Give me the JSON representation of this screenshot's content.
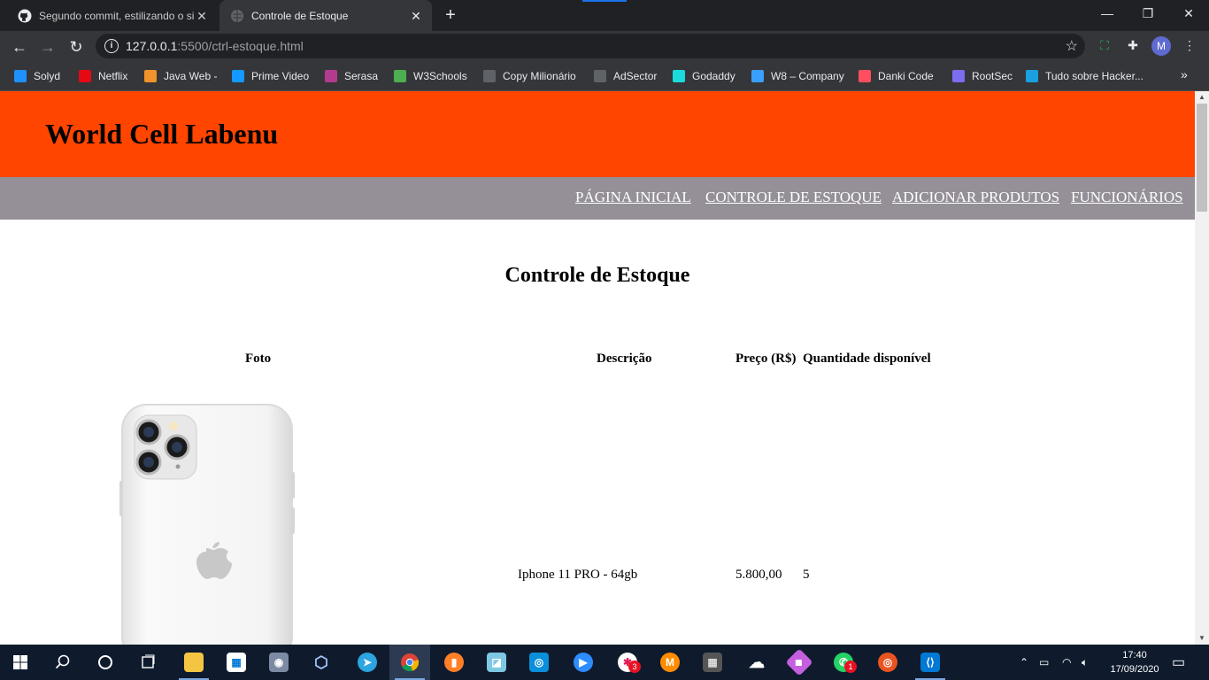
{
  "browser": {
    "tabs": [
      {
        "title": "Segundo commit, estilizando o si",
        "active": false
      },
      {
        "title": "Controle de Estoque",
        "active": true
      }
    ],
    "new_tab": "+",
    "url_host": "127.0.0.1",
    "url_rest": ":5500/ctrl-estoque.html",
    "profile_initial": "M",
    "window_controls": {
      "minimize": "—",
      "maximize": "❐",
      "close": "✕"
    },
    "bookmarks": [
      {
        "label": "Solyd",
        "icon": "solyd-icon",
        "color": "#1e90ff"
      },
      {
        "label": "Netflix",
        "icon": "netflix-icon",
        "color": "#e50914"
      },
      {
        "label": "Java Web -",
        "icon": "java-icon",
        "color": "#f0932b"
      },
      {
        "label": "Prime Video",
        "icon": "prime-video-icon",
        "color": "#1399ff"
      },
      {
        "label": "Serasa",
        "icon": "serasa-icon",
        "color": "#b23b8f"
      },
      {
        "label": "W3Schools",
        "icon": "w3schools-icon",
        "color": "#4caf50"
      },
      {
        "label": "Copy Milionário",
        "icon": "globe-icon",
        "color": "#5f6368"
      },
      {
        "label": "AdSector",
        "icon": "globe-icon",
        "color": "#5f6368"
      },
      {
        "label": "Godaddy",
        "icon": "godaddy-icon",
        "color": "#1bdbdb"
      },
      {
        "label": "W8 – Company",
        "icon": "w8-icon",
        "color": "#3aa0ff"
      },
      {
        "label": "Danki Code",
        "icon": "code-icon",
        "color": "#ff4f5e"
      },
      {
        "label": "RootSec",
        "icon": "rootsec-icon",
        "color": "#7c6cf0"
      },
      {
        "label": "Tudo sobre Hacker...",
        "icon": "hacker-icon",
        "color": "#1a9fe0"
      }
    ]
  },
  "site": {
    "title": "World Cell Labenu",
    "nav": [
      "PÁGINA INICIAL",
      "CONTROLE DE ESTOQUE",
      "ADICIONAR PRODUTOS",
      "FUNCIONÁRIOS"
    ],
    "heading": "Controle de Estoque",
    "table": {
      "headers": [
        "Foto",
        "Descrição",
        "Preço (R$)",
        "Quantidade disponível"
      ],
      "rows": [
        {
          "photo": "iphone-11-pro-white-image",
          "description": "Iphone 11 PRO - 64gb",
          "price": "5.800,00",
          "quantity": "5"
        }
      ]
    },
    "colors": {
      "header": "#ff4500",
      "nav": "#958f97"
    }
  },
  "taskbar": {
    "clock_time": "17:40",
    "clock_date": "17/09/2020",
    "slack_badge": "3",
    "whatsapp_badge": "1"
  }
}
